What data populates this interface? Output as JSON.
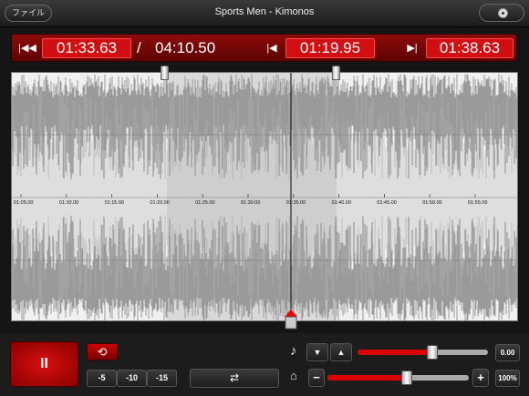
{
  "titlebar": {
    "file_label": "ファイル",
    "title": "Sports Men - Kimonos"
  },
  "timebar": {
    "loop_start": "01:33.63",
    "separator": "/",
    "total": "04:10.50",
    "current": "01:19.95",
    "loop_end": "01:38.63"
  },
  "waveform": {
    "ticks": [
      "01:05.00",
      "01:10.00",
      "01:15.00",
      "01:20.00",
      "01:25.00",
      "01:30.00",
      "01:35.00",
      "01:40.00",
      "01:45.00",
      "01:50.00",
      "01:55.00"
    ]
  },
  "controls": {
    "play_symbol": "II",
    "loop_symbol": "⟲",
    "skip": [
      "-5",
      "-10",
      "-15"
    ],
    "fx_symbol": "⇄",
    "note_symbol": "♪",
    "metro_symbol": "⌂",
    "down_symbol": "▼",
    "up_symbol": "▲",
    "minus_symbol": "−",
    "plus_symbol": "+",
    "pitch_value": "0.00",
    "speed_value": "100%",
    "pitch_level": 0.57,
    "speed_level": 0.56
  },
  "colors": {
    "accent": "#d10f12",
    "timebar": "#7a0606"
  }
}
